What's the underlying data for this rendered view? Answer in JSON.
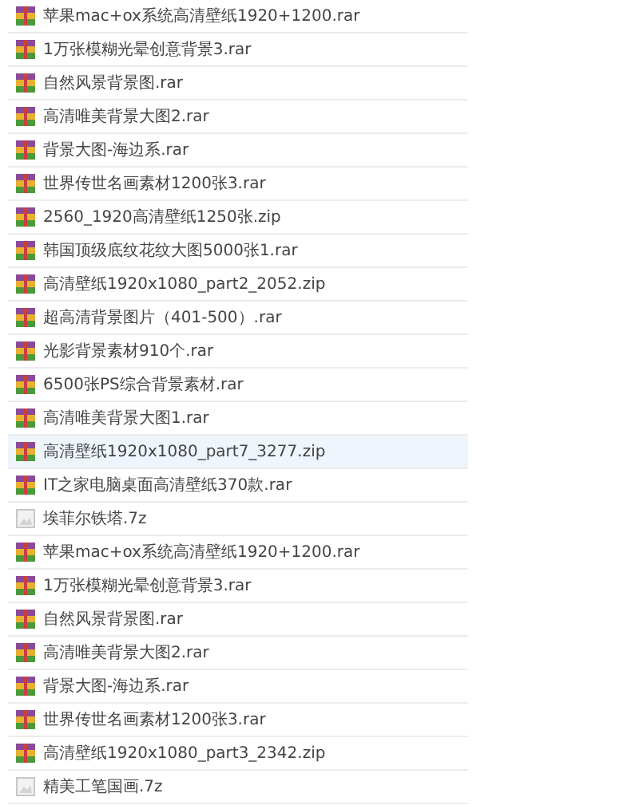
{
  "files": [
    {
      "name": "苹果mac+ox系统高清壁纸1920+1200.rar",
      "kind": "archive",
      "selected": false
    },
    {
      "name": "1万张模糊光晕创意背景3.rar",
      "kind": "archive",
      "selected": false
    },
    {
      "name": "自然风景背景图.rar",
      "kind": "archive",
      "selected": false
    },
    {
      "name": "高清唯美背景大图2.rar",
      "kind": "archive",
      "selected": false
    },
    {
      "name": "背景大图-海边系.rar",
      "kind": "archive",
      "selected": false
    },
    {
      "name": "世界传世名画素材1200张3.rar",
      "kind": "archive",
      "selected": false
    },
    {
      "name": "2560_1920高清壁纸1250张.zip",
      "kind": "archive",
      "selected": false
    },
    {
      "name": "韩国顶级底纹花纹大图5000张1.rar",
      "kind": "archive",
      "selected": false
    },
    {
      "name": "高清壁纸1920x1080_part2_2052.zip",
      "kind": "archive",
      "selected": false
    },
    {
      "name": "超高清背景图片（401-500）.rar",
      "kind": "archive",
      "selected": false
    },
    {
      "name": "光影背景素材910个.rar",
      "kind": "archive",
      "selected": false
    },
    {
      "name": "6500张PS综合背景素材.rar",
      "kind": "archive",
      "selected": false
    },
    {
      "name": "高清唯美背景大图1.rar",
      "kind": "archive",
      "selected": false
    },
    {
      "name": "高清壁纸1920x1080_part7_3277.zip",
      "kind": "archive",
      "selected": true
    },
    {
      "name": "IT之家电脑桌面高清壁纸370款.rar",
      "kind": "archive",
      "selected": false
    },
    {
      "name": "埃菲尔铁塔.7z",
      "kind": "file",
      "selected": false
    },
    {
      "name": "苹果mac+ox系统高清壁纸1920+1200.rar",
      "kind": "archive",
      "selected": false
    },
    {
      "name": "1万张模糊光晕创意背景3.rar",
      "kind": "archive",
      "selected": false
    },
    {
      "name": "自然风景背景图.rar",
      "kind": "archive",
      "selected": false
    },
    {
      "name": "高清唯美背景大图2.rar",
      "kind": "archive",
      "selected": false
    },
    {
      "name": "背景大图-海边系.rar",
      "kind": "archive",
      "selected": false
    },
    {
      "name": "世界传世名画素材1200张3.rar",
      "kind": "archive",
      "selected": false
    },
    {
      "name": "高清壁纸1920x1080_part3_2342.zip",
      "kind": "archive",
      "selected": false
    },
    {
      "name": "精美工笔国画.7z",
      "kind": "file",
      "selected": false
    }
  ]
}
